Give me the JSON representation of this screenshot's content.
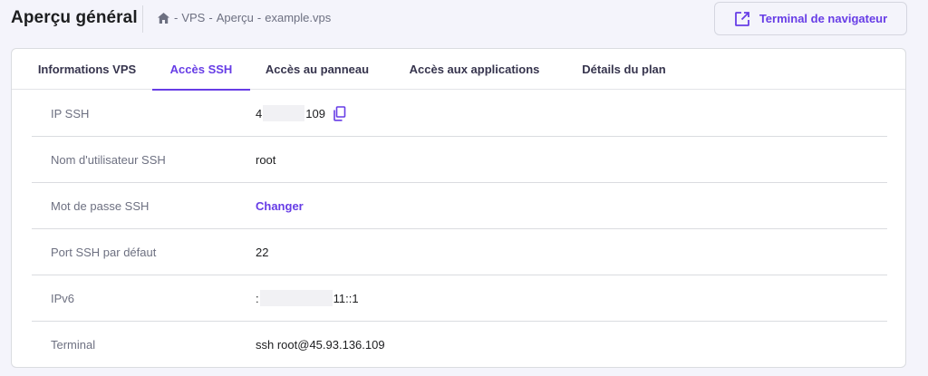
{
  "header": {
    "title": "Aperçu général",
    "breadcrumb": {
      "home_icon": "home-icon",
      "sep": "-",
      "items": [
        "VPS",
        "Aperçu",
        "example.vps"
      ]
    },
    "terminal_button": {
      "label": "Terminal de navigateur",
      "icon": "external-link-icon"
    }
  },
  "tabs": [
    {
      "label": "Informations VPS",
      "active": false
    },
    {
      "label": "Accès SSH",
      "active": true
    },
    {
      "label": "Accès au panneau",
      "active": false
    },
    {
      "label": "Accès aux applications",
      "active": false
    },
    {
      "label": "Détails du plan",
      "active": false
    }
  ],
  "rows": [
    {
      "label": "IP SSH",
      "value_prefix": "4",
      "value_suffix": "109",
      "icon": "copy-icon"
    },
    {
      "label": "Nom d'utilisateur SSH",
      "value": "root"
    },
    {
      "label": "Mot de passe SSH",
      "link": "Changer"
    },
    {
      "label": "Port SSH par défaut",
      "value": "22"
    },
    {
      "label": "IPv6",
      "value_prefix": ":",
      "value_suffix": "11::1"
    },
    {
      "label": "Terminal",
      "value": "ssh root@45.93.136.109"
    }
  ],
  "colors": {
    "accent": "#673de6",
    "background": "#f4f4fb",
    "card": "#ffffff",
    "label": "#6d7081",
    "text": "#1d1e20"
  }
}
